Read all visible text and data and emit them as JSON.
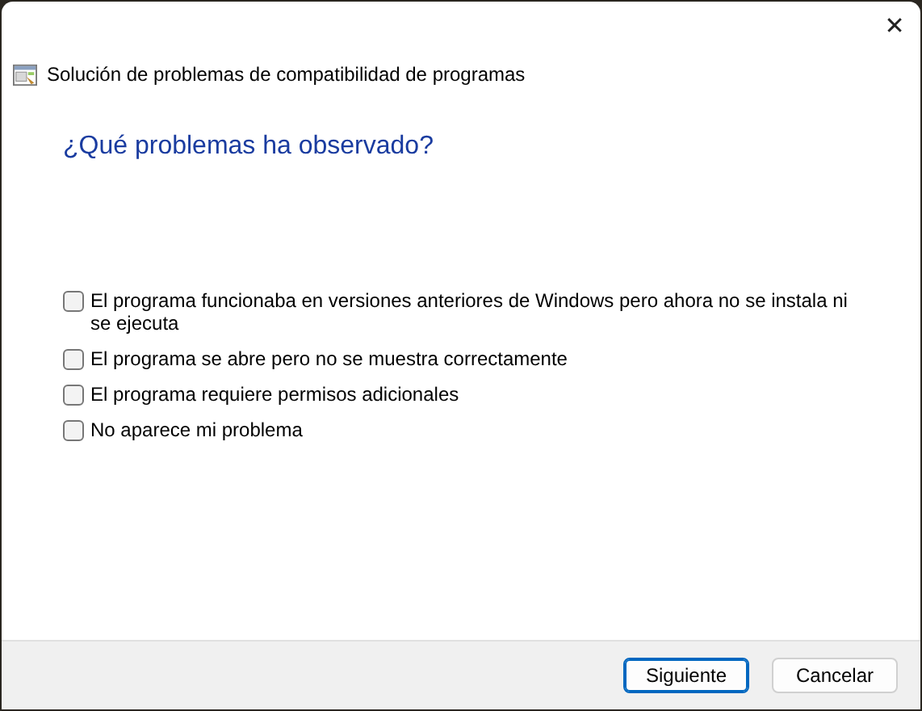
{
  "window": {
    "title": "Solución de problemas de compatibilidad de programas",
    "close": "✕"
  },
  "heading": "¿Qué problemas ha observado?",
  "options": [
    {
      "label": "El programa funcionaba en versiones anteriores de Windows pero ahora no se instala ni se ejecuta",
      "checked": false
    },
    {
      "label": "El programa se abre pero no se muestra correctamente",
      "checked": false
    },
    {
      "label": "El programa requiere permisos adicionales",
      "checked": false
    },
    {
      "label": "No aparece mi problema",
      "checked": false
    }
  ],
  "buttons": [
    {
      "label": "Siguiente",
      "default": true
    },
    {
      "label": "Cancelar",
      "default": false
    }
  ]
}
